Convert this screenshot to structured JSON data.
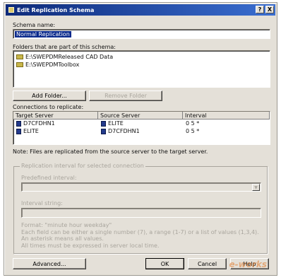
{
  "window": {
    "title": "Edit Replication Schema",
    "help_btn": "?",
    "close_btn": "X"
  },
  "schema_name": {
    "label": "Schema name:",
    "value": "Normal Replication"
  },
  "folders": {
    "label": "Folders that are part of this schema:",
    "items": [
      "E:\\SWEPDMReleased CAD Data",
      "E:\\SWEPDMToolbox"
    ],
    "add_button": "Add Folder...",
    "remove_button": "Remove Folder"
  },
  "connections": {
    "label": "Connections to replicate:",
    "columns": [
      "Target Server",
      "Source Server",
      "Interval"
    ],
    "rows": [
      {
        "target": "D7CFDHN1",
        "source": "ELITE",
        "interval": "0 5 *"
      },
      {
        "target": "ELITE",
        "source": "D7CFDHN1",
        "interval": "0 5 *"
      }
    ]
  },
  "note": "Note: Files are replicated from the source server to the target server.",
  "interval_group": {
    "title": "Replication interval for selected connection",
    "predefined_label": "Predefined interval:",
    "interval_string_label": "Interval string:",
    "format_line": "Format: \"minute hour weekday\"",
    "help_line1": "Each field can be either a single number (7), a range (1-7) or a list of values (1,3,4). An asterisk means all values.",
    "help_line2": "All times must be expressed in server local time."
  },
  "footer": {
    "advanced_button": "Advanced...",
    "ok_button": "OK",
    "cancel_button": "Cancel",
    "help_button": "Help"
  },
  "watermark": "e-works",
  "colors": {
    "title_bar_start": "#0d2a7a",
    "title_bar_end": "#3a6ed0",
    "selection": "#0a2a8c",
    "dialog_bg": "#e4e0d8"
  }
}
